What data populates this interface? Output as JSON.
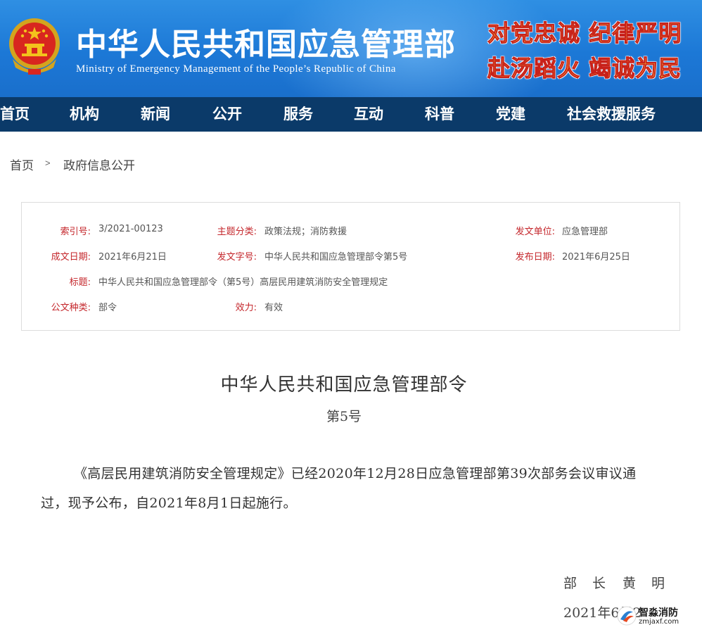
{
  "header": {
    "site_title": "中华人民共和国应急管理部",
    "site_subtitle": "Ministry of Emergency Management of the People’s Republic of China",
    "slogan_line1": "对党忠诚  纪律严明",
    "slogan_line2": "赴汤蹈火  竭诚为民"
  },
  "nav": {
    "items": [
      "首页",
      "机构",
      "新闻",
      "公开",
      "服务",
      "互动",
      "科普",
      "党建",
      "社会救援服务"
    ]
  },
  "breadcrumb": {
    "home": "首页",
    "separator": ">",
    "current": "政府信息公开"
  },
  "info": {
    "index_label": "索引号:",
    "index_value": "3/2021-00123",
    "category_label": "主题分类:",
    "category_value": "政策法规；消防救援",
    "issuer_label": "发文单位:",
    "issuer_value": "应急管理部",
    "written_label": "成文日期:",
    "written_value": "2021年6月21日",
    "docno_label": "发文字号:",
    "docno_value": "中华人民共和国应急管理部令第5号",
    "publish_label": "发布日期:",
    "publish_value": "2021年6月25日",
    "title_label": "标题:",
    "title_value": "中华人民共和国应急管理部令（第5号）高层民用建筑消防安全管理规定",
    "type_label": "公文种类:",
    "type_value": "部令",
    "validity_label": "效力:",
    "validity_value": "有效"
  },
  "article": {
    "title": "中华人民共和国应急管理部令",
    "number": "第5号",
    "body": "《高层民用建筑消防安全管理规定》已经2020年12月28日应急管理部第39次部务会议审议通过，现予公布，自2021年8月1日起施行。",
    "signature_role": "部 长",
    "signature_name": "黄 明",
    "signature_date": "2021年6月2"
  },
  "watermark": {
    "title": "智淼消防",
    "url": "zmjaxf.com"
  },
  "colors": {
    "header_blue": "#1c78d6",
    "nav_navy": "#0b3a69",
    "label_red": "#c4262b",
    "slogan_yellow": "#ffe03a"
  }
}
